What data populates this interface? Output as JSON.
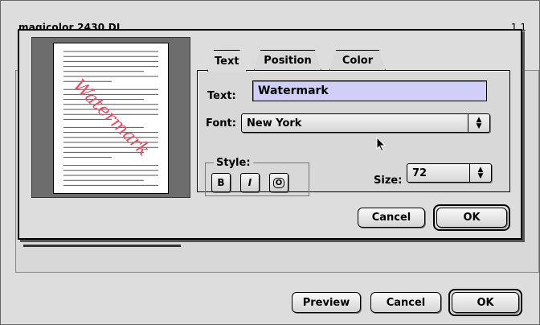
{
  "background_window": {
    "title": "magicolor 2430 DL",
    "right_text": "1.1",
    "buttons": {
      "preview": "Preview",
      "cancel": "Cancel",
      "ok": "OK"
    }
  },
  "watermark_dialog": {
    "preview": {
      "watermark_text": "Watermark",
      "watermark_color": "#e0506a"
    },
    "tabs": [
      {
        "label": "Text",
        "active": true
      },
      {
        "label": "Position",
        "active": false
      },
      {
        "label": "Color",
        "active": false
      }
    ],
    "text_label": "Text:",
    "text_value": "Watermark",
    "font_label": "Font:",
    "font_value": "New York",
    "style_label": "Style:",
    "style_buttons": {
      "bold": "B",
      "italic": "I",
      "outline": "O"
    },
    "size_label": "Size:",
    "size_value": "72",
    "buttons": {
      "cancel": "Cancel",
      "ok": "OK"
    }
  },
  "colors": {
    "field_highlight": "#cfcff8",
    "window_bg": "#dddddd"
  }
}
